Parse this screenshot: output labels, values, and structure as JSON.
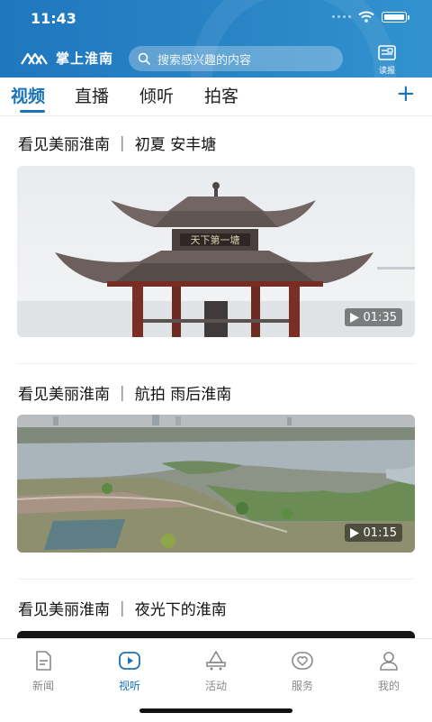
{
  "status": {
    "time": "11:43"
  },
  "header": {
    "app_name": "掌上淮南",
    "search_placeholder": "搜索感兴趣的内容",
    "reader_label": "读报"
  },
  "tabs": [
    {
      "label": "视频",
      "active": true
    },
    {
      "label": "直播",
      "active": false
    },
    {
      "label": "倾听",
      "active": false
    },
    {
      "label": "拍客",
      "active": false
    }
  ],
  "cards": [
    {
      "title": "看见美丽淮南 ｜ 初夏 安丰塘",
      "duration": "01:35",
      "sign_text": "天下第一塘"
    },
    {
      "title": "看见美丽淮南 ｜ 航拍 雨后淮南",
      "duration": "01:15"
    },
    {
      "title": "看见美丽淮南 ｜ 夜光下的淮南"
    }
  ],
  "bottom_nav": [
    {
      "label": "新闻",
      "icon": "news-icon",
      "active": false
    },
    {
      "label": "视听",
      "icon": "video-play-icon",
      "active": true
    },
    {
      "label": "活动",
      "icon": "activity-icon",
      "active": false
    },
    {
      "label": "服务",
      "icon": "service-heart-icon",
      "active": false
    },
    {
      "label": "我的",
      "icon": "profile-icon",
      "active": false
    }
  ],
  "colors": {
    "header_blue": "#1f77be",
    "accent": "#1a73b8"
  }
}
